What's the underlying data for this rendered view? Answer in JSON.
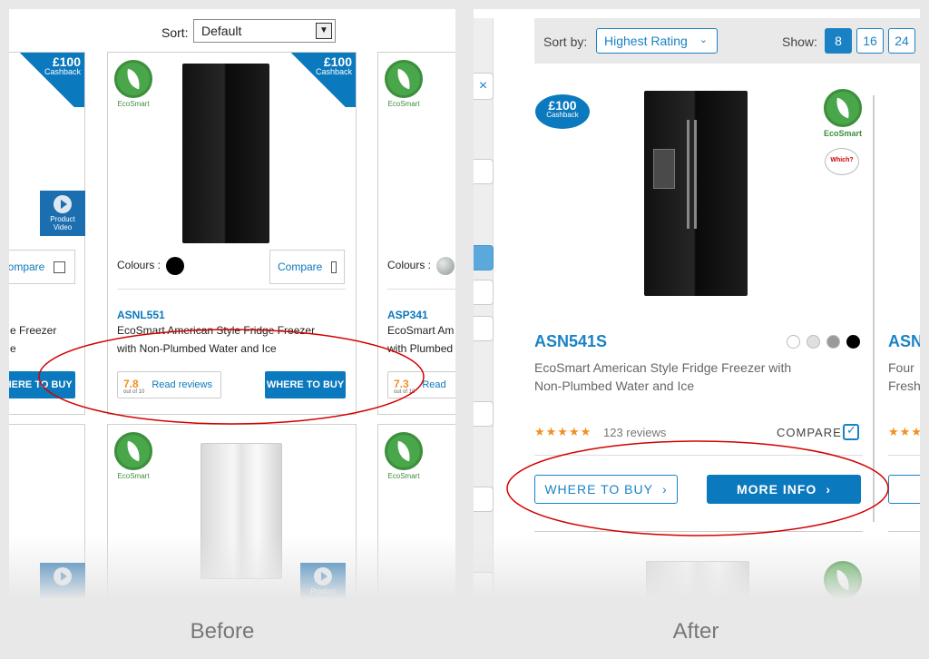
{
  "before": {
    "caption": "Before",
    "sort": {
      "label": "Sort:",
      "value": "Default"
    },
    "left_card": {
      "cashback_amount": "£100",
      "cashback_label": "Cashback",
      "video_label": "Product Video",
      "compare_label": "Compare",
      "desc_partial_1": "e Freezer",
      "desc_partial_2": "e",
      "where_to_buy": "WHERE TO BUY"
    },
    "main_card": {
      "eco_label": "EcoSmart",
      "cashback_amount": "£100",
      "cashback_label": "Cashback",
      "colours_label": "Colours :",
      "compare_label": "Compare",
      "model": "ASNL551",
      "description_1": "EcoSmart American Style Fridge Freezer",
      "description_2": "with Non-Plumbed Water and Ice",
      "rating": "7.8",
      "rating_suffix": "out of 10",
      "read_reviews": "Read reviews",
      "where_to_buy": "WHERE TO BUY"
    },
    "right_card": {
      "eco_label": "EcoSmart",
      "colours_label": "Colours :",
      "model": "ASP341",
      "description_1": "EcoSmart Am",
      "description_2": "with Plumbed",
      "rating": "7.3",
      "rating_suffix": "out of 10",
      "read_reviews": "Read"
    },
    "row2": {
      "eco_label_1": "EcoSmart",
      "eco_label_2": "EcoSmart",
      "video_label": "Product"
    }
  },
  "after": {
    "caption": "After",
    "sort": {
      "label": "Sort by:",
      "value": "Highest Rating"
    },
    "show": {
      "label": "Show:",
      "options": [
        "8",
        "16",
        "24"
      ],
      "active": "8"
    },
    "close_symbol": "×",
    "card": {
      "cashback_amount": "£100",
      "cashback_label": "Cashback",
      "eco_label": "EcoSmart",
      "which_label": "Which?",
      "model": "ASN541S",
      "colors": [
        "#ffffff",
        "#e0e0e0",
        "#9a9a9a",
        "#000000"
      ],
      "description_1": "EcoSmart American Style Fridge Freezer with",
      "description_2": "Non-Plumbed Water and Ice",
      "stars": "★★★★★",
      "rating_fraction": 0.9,
      "reviews": "123 reviews",
      "compare": "COMPARE",
      "where_to_buy": "WHERE TO BUY",
      "more_info": "MORE INFO"
    },
    "next_card": {
      "model": "ASN",
      "description_1": "Four",
      "description_2": "Fresh",
      "stars": "★★★"
    }
  },
  "colors": {
    "brand_blue": "#0b79bd",
    "eco_green": "#4aa64a",
    "highlight_red": "#d40000",
    "rating_orange": "#f0901e"
  }
}
